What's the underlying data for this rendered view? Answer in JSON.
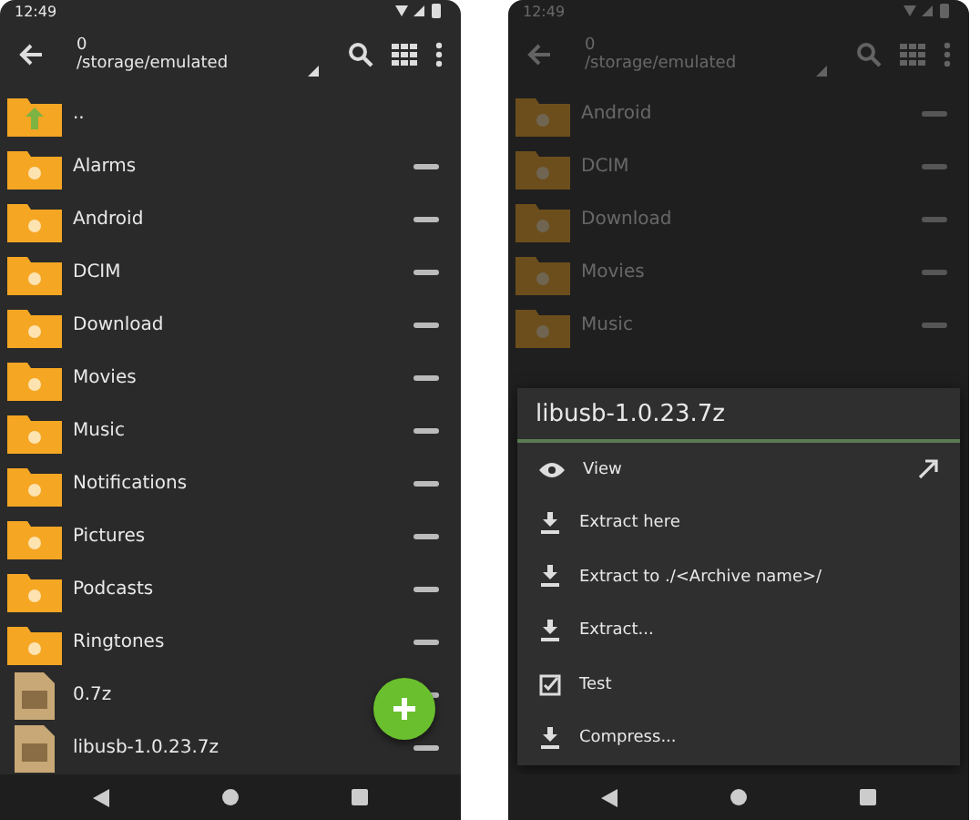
{
  "phones": [
    {
      "dimmed": false,
      "fab": {
        "kind": "add"
      },
      "status_time": "12:49",
      "toolbar": {
        "title": "0",
        "path": "/storage/emulated"
      },
      "items": [
        {
          "name": "..",
          "kind": "up"
        },
        {
          "name": "Alarms",
          "kind": "folder"
        },
        {
          "name": "Android",
          "kind": "folder"
        },
        {
          "name": "DCIM",
          "kind": "folder"
        },
        {
          "name": "Download",
          "kind": "folder"
        },
        {
          "name": "Movies",
          "kind": "folder"
        },
        {
          "name": "Music",
          "kind": "folder"
        },
        {
          "name": "Notifications",
          "kind": "folder"
        },
        {
          "name": "Pictures",
          "kind": "folder"
        },
        {
          "name": "Podcasts",
          "kind": "folder"
        },
        {
          "name": "Ringtones",
          "kind": "folder"
        },
        {
          "name": "0.7z",
          "kind": "archive"
        },
        {
          "name": "libusb-1.0.23.7z",
          "kind": "archive"
        }
      ]
    },
    {
      "dimmed": true,
      "status_time": "12:49",
      "toolbar": {
        "title": "0",
        "path": "/storage/emulated"
      },
      "items": [
        {
          "name": "Android",
          "kind": "folder"
        },
        {
          "name": "DCIM",
          "kind": "folder"
        },
        {
          "name": "Download",
          "kind": "folder"
        },
        {
          "name": "Movies",
          "kind": "folder"
        },
        {
          "name": "Music",
          "kind": "folder"
        }
      ],
      "dialog": {
        "title": "libusb-1.0.23.7z",
        "options": [
          {
            "label": "View",
            "kind": "view"
          },
          {
            "label": "Extract here",
            "kind": "extract"
          },
          {
            "label": "Extract to ./<Archive name>/",
            "kind": "extract"
          },
          {
            "label": "Extract...",
            "kind": "extract"
          },
          {
            "label": "Test",
            "kind": "test"
          },
          {
            "label": "Compress...",
            "kind": "compress"
          }
        ]
      }
    }
  ]
}
